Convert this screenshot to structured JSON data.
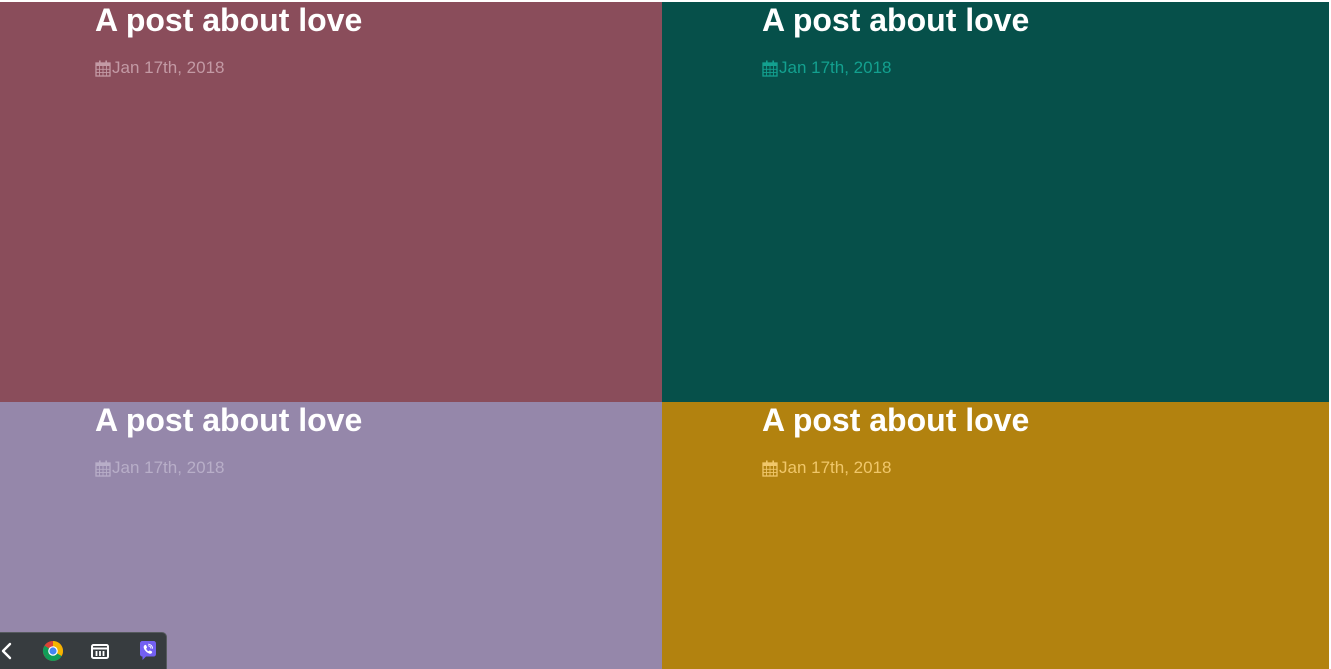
{
  "posts": [
    {
      "title": "A post about love",
      "date": "Jan 17th, 2018",
      "bg_color": "#8a4d5b",
      "date_color": "#c39aa5",
      "icon": "calendar-icon"
    },
    {
      "title": "A post about love",
      "date": "Jan 17th, 2018",
      "bg_color": "#06504a",
      "date_color": "#13a08f",
      "icon": "calendar-icon"
    },
    {
      "title": "A post about love",
      "date": "Jan 17th, 2018",
      "bg_color": "#9587aa",
      "date_color": "#b8aec8",
      "icon": "calendar-icon"
    },
    {
      "title": "A post about love",
      "date": "Jan 17th, 2018",
      "bg_color": "#b2820f",
      "date_color": "#f0c76a",
      "icon": "calendar-icon"
    }
  ],
  "taskbar": {
    "items": [
      "back-arrow-icon",
      "chrome-icon",
      "files-icon",
      "viber-icon"
    ],
    "bg_color": "#373c3f"
  }
}
